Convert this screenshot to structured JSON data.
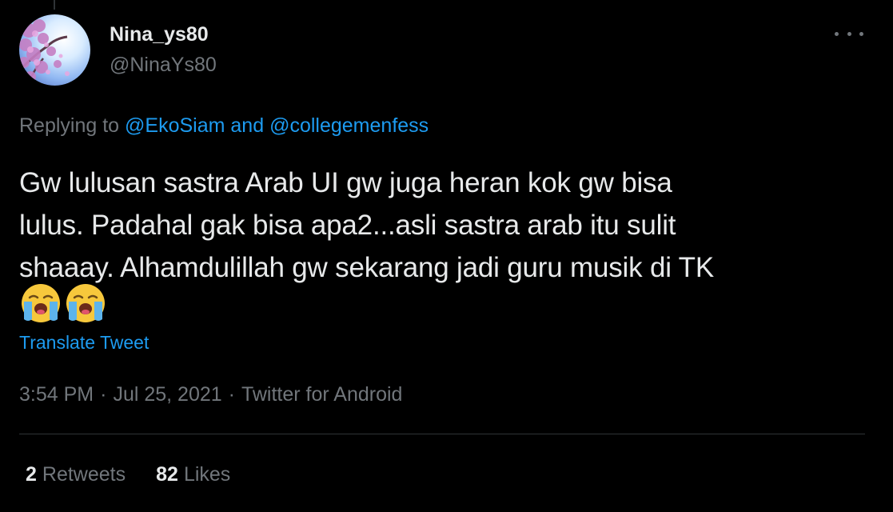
{
  "tweet": {
    "display_name": "Nina_ys80",
    "handle": "@NinaYs80",
    "replying_to_prefix": "Replying to",
    "replying_to_users": [
      "@EkoSiam",
      "@collegemenfess"
    ],
    "replying_to_joiner": "and",
    "text_lines": [
      "Gw lulusan sastra Arab UI gw juga heran kok gw bisa",
      "lulus. Padahal gak bisa apa2...asli sastra arab itu sulit",
      "shaaay. Alhamdulillah gw sekarang jadi guru musik di TK"
    ],
    "emojis": [
      "loudly-crying-face-icon",
      "loudly-crying-face-icon"
    ],
    "translate_label": "Translate Tweet",
    "time": "3:54 PM",
    "date": "Jul 25, 2021",
    "source": "Twitter for Android",
    "separator": "·",
    "retweets_count": "2",
    "retweets_label": "Retweets",
    "likes_count": "82",
    "likes_label": "Likes"
  },
  "colors": {
    "background": "#000000",
    "primary_text": "#e7e9ea",
    "secondary_text": "#71767b",
    "accent": "#1d9bf0",
    "divider": "#2f3336"
  },
  "icons": {
    "more": "more-options-icon",
    "avatar": "avatar-cherry-blossom"
  }
}
